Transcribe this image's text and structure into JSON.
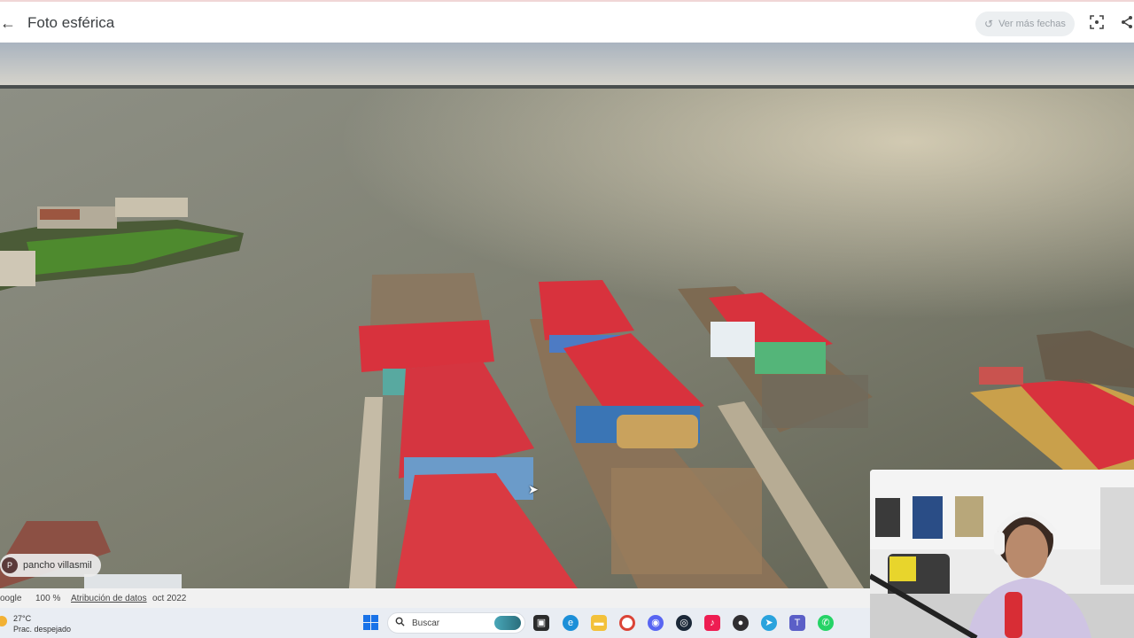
{
  "header": {
    "back_icon": "arrow-left-icon",
    "title": "Foto esférica",
    "dates_button": "Ver más fechas",
    "history_icon": "history-icon",
    "fullscreen_icon": "fullscreen-icon",
    "share_icon": "share-icon"
  },
  "photo": {
    "author_initial": "P",
    "author_name": "pancho villasmil"
  },
  "map_footer": {
    "brand": "oogle",
    "zoom": "100 %",
    "attribution": "Atribución de datos",
    "date": "oct 2022"
  },
  "taskbar": {
    "weather_temp": "27°C",
    "weather_desc": "Prac. despejado",
    "search_label": "Buscar",
    "apps": [
      "windows-start-icon",
      "file-explorer-icon",
      "edge-icon",
      "folder-icon",
      "chrome-icon",
      "discord-icon",
      "steam-icon",
      "tiktok-icon",
      "obs-icon",
      "telegram-icon",
      "teams-icon",
      "whatsapp-icon"
    ]
  },
  "colors": {
    "roof_red": "#d8323d",
    "water": "#747565",
    "taskbar": "#e9edf3"
  }
}
